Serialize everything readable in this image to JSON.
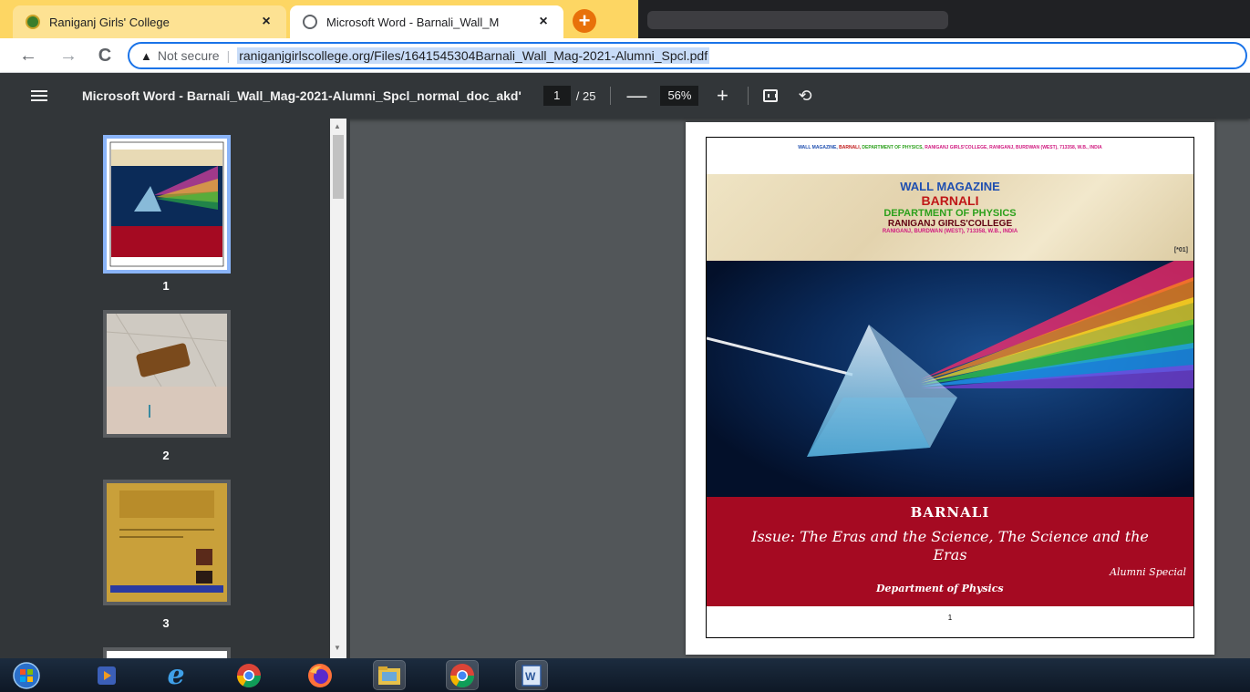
{
  "tabs": [
    {
      "title": "Raniganj Girls' College",
      "close": "×"
    },
    {
      "title": "Microsoft Word - Barnali_Wall_M",
      "close": "×"
    }
  ],
  "new_tab_label": "+",
  "address": {
    "warning_icon": "▲",
    "not_secure": "Not secure",
    "separator": "|",
    "url": "raniganjgirlscollege.org/Files/1641545304Barnali_Wall_Mag-2021-Alumni_Spcl.pdf"
  },
  "nav": {
    "back": "←",
    "forward": "→",
    "reload": "C"
  },
  "pdf_toolbar": {
    "title": "Microsoft Word - Barnali_Wall_Mag-2021-Alumni_Spcl_normal_doc_akd'",
    "current_page": "1",
    "total_pages": "/ 25",
    "zoom_out": "—",
    "zoom": "56%",
    "zoom_in": "+",
    "rotate": "⟲"
  },
  "thumbnails": [
    {
      "number": "1"
    },
    {
      "number": "2"
    },
    {
      "number": "3"
    }
  ],
  "page": {
    "header_line": {
      "part1": "WALL MAGAZINE, ",
      "part2": "BARNALI, ",
      "part3": "DEPARTMENT OF PHYSICS, ",
      "part4": "RANIGANJ GIRLS'COLLEGE, RANIGANJ, BURDWAN (WEST), 713358, W.B., INDIA"
    },
    "banner": {
      "line1": "WALL MAGAZINE",
      "line2": "BARNALI",
      "line3": "DEPARTMENT OF PHYSICS",
      "line4": "RANIGANJ GIRLS'COLLEGE",
      "line5": "RANIGANJ, BURDWAN (WEST), 713358, W.B., INDIA",
      "code": "[*01]"
    },
    "red_band": {
      "title": "BARNALI",
      "issue": "Issue:  The Eras and  the Science, The Science and the Eras",
      "special": "Alumni Special",
      "dept": "Department of Physics"
    },
    "page_number": "1"
  },
  "colors": {
    "accent_blue": "#1a73e8",
    "band_red": "#a50a22",
    "pdf_toolbar": "#323639"
  }
}
